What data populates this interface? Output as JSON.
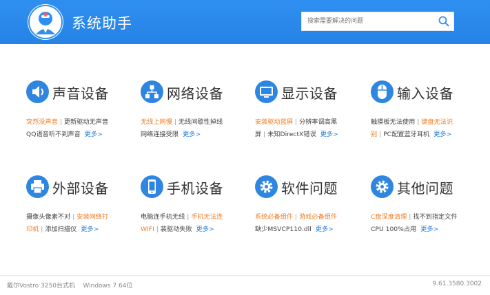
{
  "header": {
    "title": "系统助手",
    "search_placeholder": "搜索需要解决的问题"
  },
  "categories": [
    {
      "title": "声音设备",
      "icon": "speaker-icon",
      "line1": [
        {
          "text": "突然没声音",
          "hl": true
        },
        {
          "text": "更新驱动无声音",
          "hl": false
        }
      ],
      "line2": [
        {
          "text": "QQ语音听不到声音",
          "hl": false
        }
      ]
    },
    {
      "title": "网络设备",
      "icon": "network-icon",
      "line1": [
        {
          "text": "无线上网慢",
          "hl": true
        },
        {
          "text": "无线间歇性掉线",
          "hl": false
        }
      ],
      "line2": [
        {
          "text": "网络连接受限",
          "hl": false
        }
      ]
    },
    {
      "title": "显示设备",
      "icon": "monitor-icon",
      "line1": [
        {
          "text": "安装驱动蓝屏",
          "hl": true
        },
        {
          "text": "分辨率调高黑",
          "hl": false
        }
      ],
      "line2": [
        {
          "text": "屏",
          "hl": false
        },
        {
          "text": "未知DirectX错误",
          "hl": false
        }
      ]
    },
    {
      "title": "输入设备",
      "icon": "mouse-icon",
      "line1": [
        {
          "text": "触摸板无法使用",
          "hl": false
        },
        {
          "text": "键盘无法识",
          "hl": true
        }
      ],
      "line2": [
        {
          "text": "别",
          "hl": true
        },
        {
          "text": "PC配置蓝牙耳机",
          "hl": false
        }
      ]
    },
    {
      "title": "外部设备",
      "icon": "printer-icon",
      "line1": [
        {
          "text": "摄像头像素不对",
          "hl": false
        },
        {
          "text": "安装网络打",
          "hl": true
        }
      ],
      "line2": [
        {
          "text": "印机",
          "hl": true
        },
        {
          "text": "添加扫描仪",
          "hl": false
        }
      ]
    },
    {
      "title": "手机设备",
      "icon": "phone-icon",
      "line1": [
        {
          "text": "电脑连手机无线",
          "hl": false
        },
        {
          "text": "手机无法连",
          "hl": true
        }
      ],
      "line2": [
        {
          "text": "WIFI",
          "hl": true
        },
        {
          "text": "装驱动失败",
          "hl": false
        }
      ]
    },
    {
      "title": "软件问题",
      "icon": "software-gear-icon",
      "line1": [
        {
          "text": "系统必备组件",
          "hl": true
        },
        {
          "text": "游戏必备组件",
          "hl": true
        }
      ],
      "line2": [
        {
          "text": "缺少MSVCP110.dll",
          "hl": false
        }
      ]
    },
    {
      "title": "其他问题",
      "icon": "other-gear-icon",
      "line1": [
        {
          "text": "C盘深度清理",
          "hl": true
        },
        {
          "text": "找不到指定文件",
          "hl": false
        }
      ],
      "line2": [
        {
          "text": "CPU 100%占用",
          "hl": false
        }
      ]
    }
  ],
  "more_label": "更多>",
  "footer": {
    "device": "戴尔Vostro 3250台式机",
    "os": "Windows 7 64位",
    "version": "9.61.3580.3002"
  },
  "colors": {
    "header_blue": "#2f8ff0",
    "icon_blue": "#2f86e0",
    "highlight_orange": "#f07c24",
    "link_blue": "#2b7fd8"
  }
}
